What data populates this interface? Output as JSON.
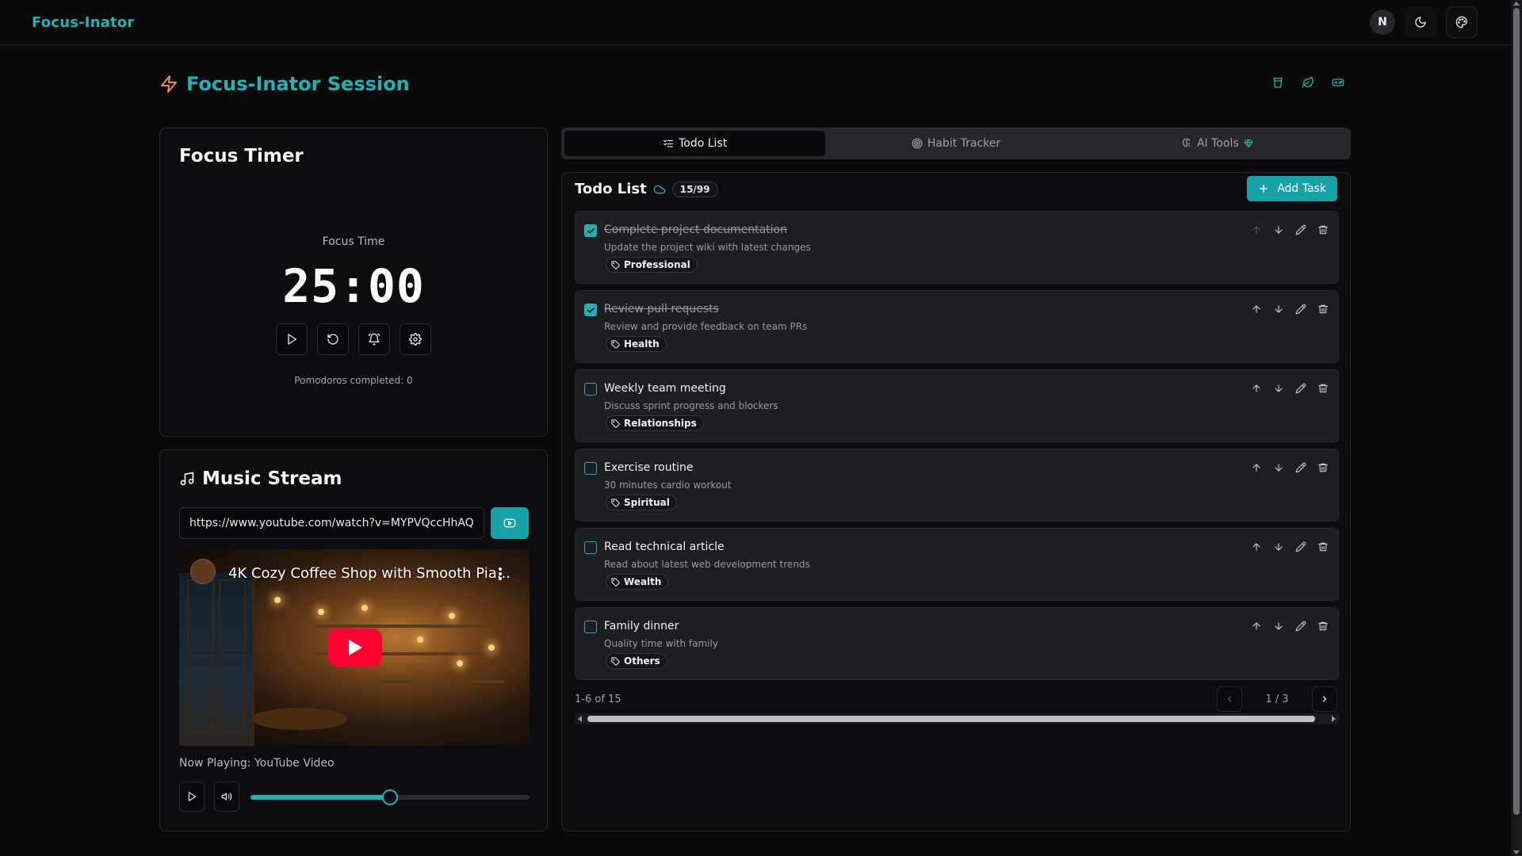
{
  "app": {
    "brand": "Focus-Inator",
    "avatar_initial": "N"
  },
  "session": {
    "title": "Focus-Inator Session"
  },
  "timer": {
    "title": "Focus Timer",
    "mode_label": "Focus Time",
    "display": "25:00",
    "pomodoros": "Pomodoros completed: 0"
  },
  "music": {
    "title": "Music Stream",
    "url": "https://www.youtube.com/watch?v=MYPVQccHhAQ",
    "video_title": "4K Cozy Coffee Shop with Smooth Pia...",
    "now_playing": "Now Playing: YouTube Video",
    "volume_fraction": 0.5
  },
  "tabs": [
    {
      "label": "Todo List",
      "active": true
    },
    {
      "label": "Habit Tracker",
      "active": false
    },
    {
      "label": "AI Tools",
      "active": false
    }
  ],
  "todo": {
    "title": "Todo List",
    "count_badge": "15/99",
    "add_label": "Add Task",
    "items": [
      {
        "title": "Complete project documentation",
        "desc": "Update the project wiki with latest changes",
        "tag": "Professional",
        "done": true
      },
      {
        "title": "Review pull requests",
        "desc": "Review and provide feedback on team PRs",
        "tag": "Health",
        "done": true
      },
      {
        "title": "Weekly team meeting",
        "desc": "Discuss sprint progress and blockers",
        "tag": "Relationships",
        "done": false
      },
      {
        "title": "Exercise routine",
        "desc": "30 minutes cardio workout",
        "tag": "Spiritual",
        "done": false
      },
      {
        "title": "Read technical article",
        "desc": "Read about latest web development trends",
        "tag": "Wealth",
        "done": false
      },
      {
        "title": "Family dinner",
        "desc": "Quality time with family",
        "tag": "Others",
        "done": false
      }
    ],
    "range_text": "1-6 of 15",
    "page_text": "1 / 3"
  },
  "colors": {
    "accent": "#1fb3b6",
    "background": "#0a0a0b",
    "card": "#1e1e22",
    "youtube_red": "#ff0033"
  }
}
